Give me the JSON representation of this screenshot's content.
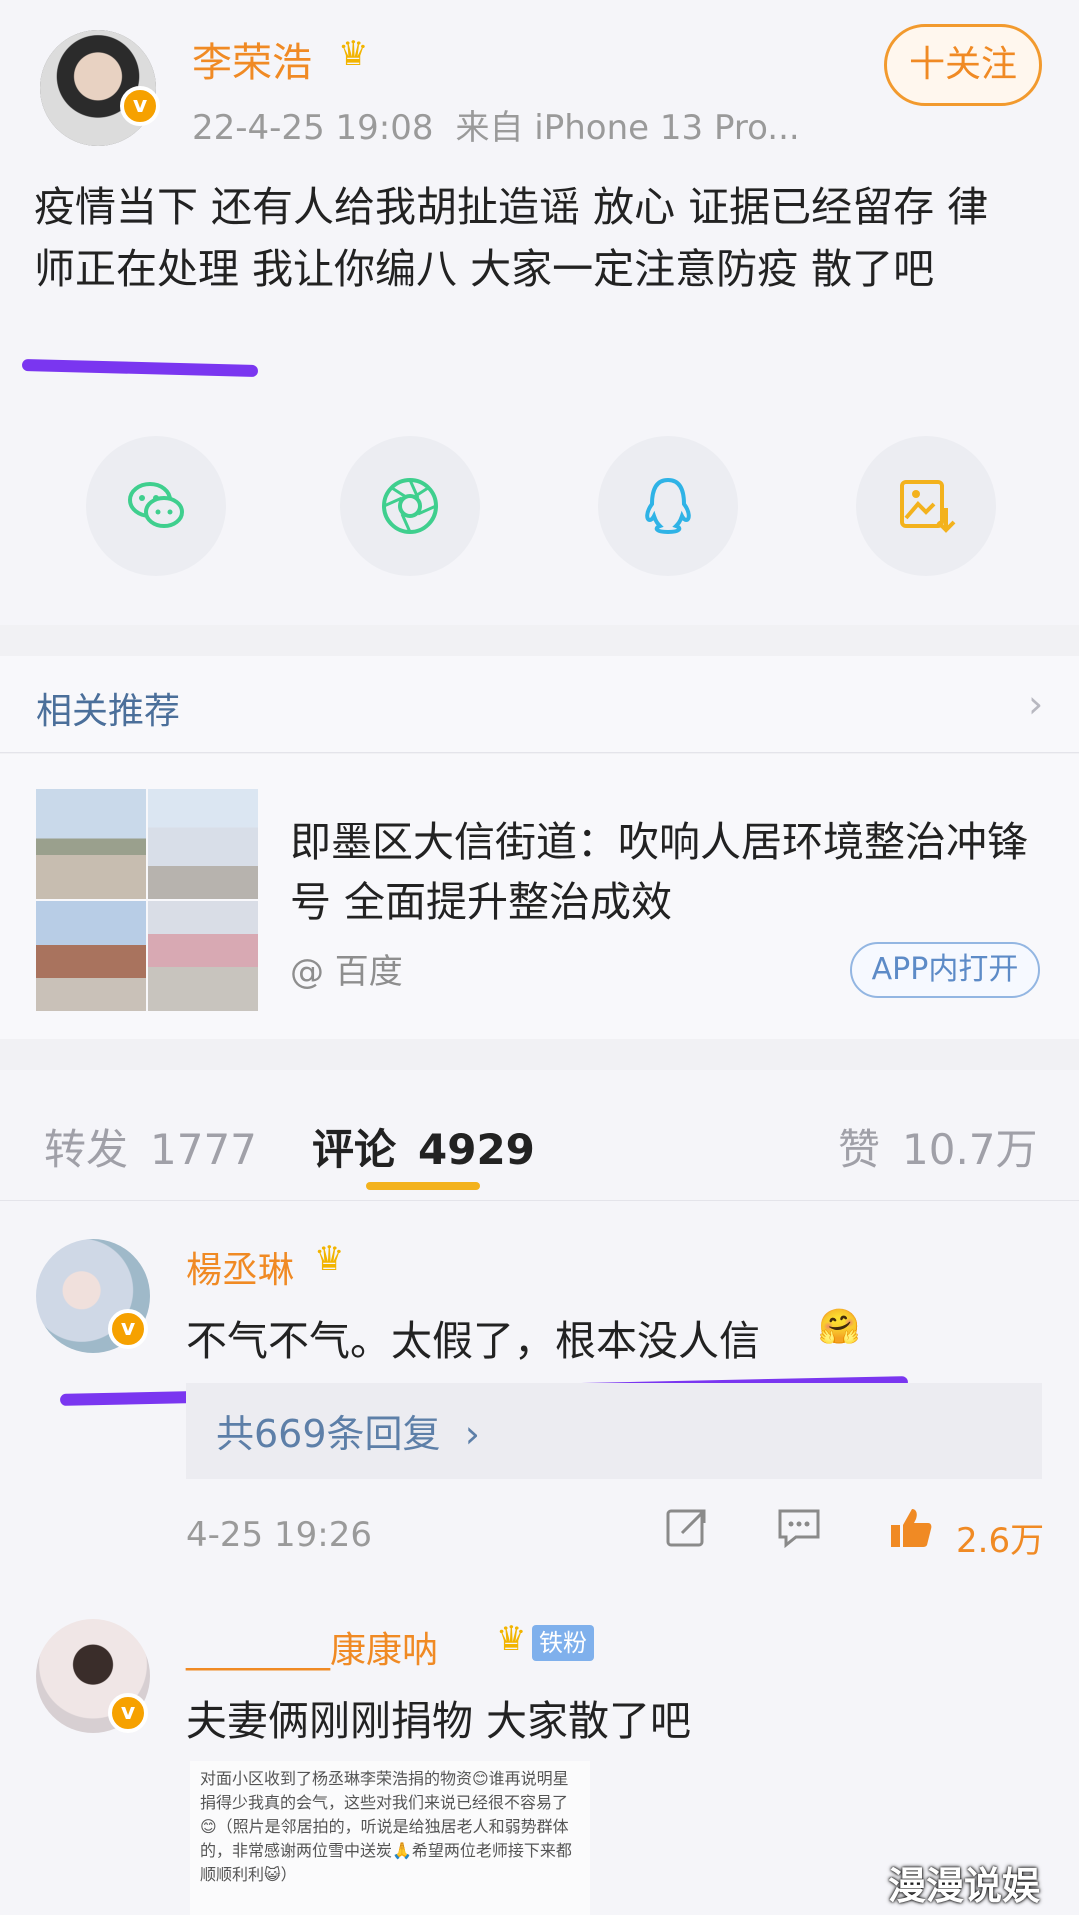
{
  "post": {
    "author": "李荣浩",
    "crown_icon": "crown-icon",
    "time": "22-4-25 19:08",
    "source": "来自 iPhone 13 Pro...",
    "follow_label": "十关注",
    "text": "疫情当下 还有人给我胡扯造谣 放心 证据已经留存 律师正在处理 我让你编八 大家一定注意防疫 散了吧",
    "share_icons": [
      "wechat-icon",
      "moments-icon",
      "qq-icon",
      "save-image-icon"
    ],
    "colors": {
      "accent": "#f08a24",
      "underline": "#7a36f0",
      "link": "#5d7fa8"
    }
  },
  "related": {
    "title": "相关推荐",
    "card": {
      "title": "即墨区大信街道：吹响人居环境整治冲锋号 全面提升整治成效",
      "source": "@ 百度",
      "open_label": "APP内打开"
    }
  },
  "tabs": {
    "repost_label": "转发",
    "repost_count": "1777",
    "comments_label": "评论",
    "comments_count": "4929",
    "likes_label": "赞",
    "likes_count": "10.7万"
  },
  "comments": [
    {
      "name": "楊丞琳",
      "text": "不气不气。太假了，根本没人信",
      "replies": "共669条回复",
      "time": "4-25 19:26",
      "likes": "2.6万"
    },
    {
      "name": "________康康呐",
      "badge": "铁粉",
      "text": "夫妻俩刚刚捐物 大家散了吧",
      "image_text": "对面小区收到了杨丞琳李荣浩捐的物资😊谁再说明星捐得少我真的会气，这些对我们来说已经很不容易了😊（照片是邻居拍的，听说是给独居老人和弱势群体的，非常感谢两位雪中送炭🙏希望两位老师接下来都顺顺利利😺）"
    }
  ],
  "watermark": "漫漫说娱"
}
